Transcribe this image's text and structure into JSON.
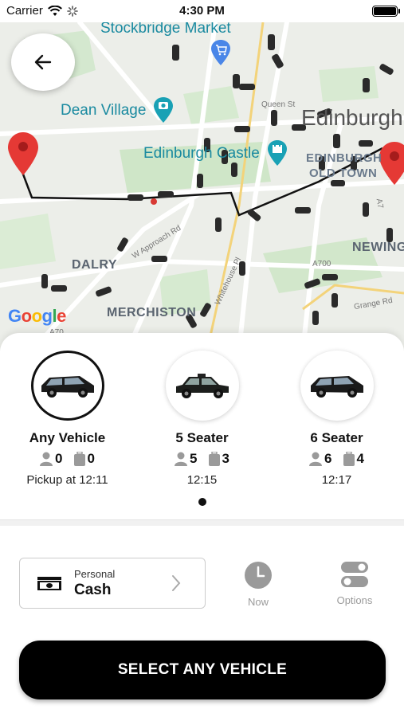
{
  "status_bar": {
    "carrier": "Carrier",
    "time": "4:30 PM"
  },
  "map": {
    "labels": {
      "stockbridge_market": "Stockbridge Market",
      "dean_village": "Dean Village",
      "edinburgh_castle": "Edinburgh Castle",
      "edinburgh": "Edinburgh",
      "edinburgh_old_town_1": "EDINBURGH",
      "edinburgh_old_town_2": "OLD TOWN",
      "dalry": "DALRY",
      "merchiston": "MERCHISTON",
      "newington": "NEWING",
      "queen_st": "Queen St",
      "w_approach_rd": "W Approach Rd",
      "a700": "A700",
      "grange_rd": "Grange Rd",
      "a70": "A70",
      "whitehouse_pl": "Whitehouse Pl",
      "a7": "A7"
    },
    "google_logo": {
      "g1": "G",
      "o1": "o",
      "o2": "o",
      "g2": "g",
      "l": "l",
      "e": "e"
    }
  },
  "vehicles": [
    {
      "name": "Any Vehicle",
      "passengers": "0",
      "luggage": "0",
      "pickup": "Pickup at 12:11",
      "selected": true
    },
    {
      "name": "5 Seater",
      "passengers": "5",
      "luggage": "3",
      "pickup": "12:15",
      "selected": false
    },
    {
      "name": "6 Seater",
      "passengers": "6",
      "luggage": "4",
      "pickup": "12:17",
      "selected": false
    }
  ],
  "payment": {
    "type": "Personal",
    "method": "Cash"
  },
  "actions": {
    "now": "Now",
    "options": "Options"
  },
  "cta": {
    "label": "SELECT ANY VEHICLE"
  },
  "colors": {
    "accent": "#000000",
    "marker": "#e53935",
    "map_teal": "#1a8aa0",
    "map_icon_blue": "#4a86e8"
  },
  "icons": [
    "back-arrow-icon",
    "wifi-icon",
    "loading-icon",
    "battery-icon",
    "pin-icon",
    "camera-icon",
    "shopping-cart-icon",
    "castle-icon",
    "person-icon",
    "luggage-icon",
    "cash-icon",
    "chevron-right-icon",
    "clock-icon",
    "toggle-icon",
    "car-icon"
  ]
}
